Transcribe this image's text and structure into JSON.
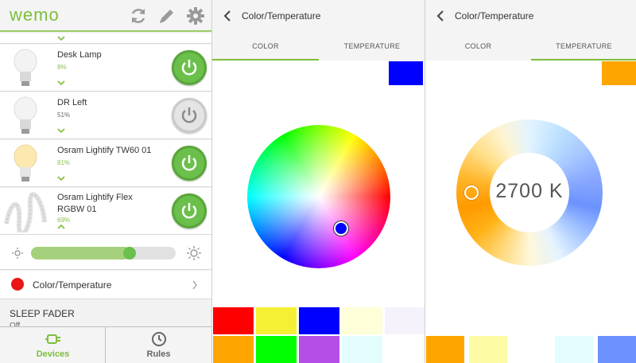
{
  "left_panel": {
    "logo": "wemo",
    "devices": [
      {
        "name": "Desk Lamp",
        "level": "8%",
        "on": true,
        "chevron": "down"
      },
      {
        "name": "DR Left",
        "level": "51%",
        "on": false,
        "chevron": "down"
      },
      {
        "name": "Osram Lightify TW60 01",
        "level": "81%",
        "on": true,
        "chevron": "down"
      },
      {
        "name": "Osram Lightify Flex",
        "name2": "RGBW 01",
        "level": "69%",
        "on": true,
        "chevron": "up"
      }
    ],
    "brightness_slider": {
      "value": 0.68
    },
    "color_row": {
      "label": "Color/Temperature",
      "color": "#e81616"
    },
    "sleep_fader": {
      "title": "SLEEP FADER",
      "value": "Off"
    },
    "nav": {
      "devices_label": "Devices",
      "rules_label": "Rules"
    },
    "colors": {
      "accent": "#7cbf3a",
      "power_on": "#6bc04b"
    }
  },
  "color_panel": {
    "title": "Color/Temperature",
    "tabs": {
      "color": "COLOR",
      "temperature": "TEMPERATURE"
    },
    "active_tab": "COLOR",
    "selected_color": "#0000ff",
    "presets": [
      "#ff0000",
      "#f5f034",
      "#0000ff",
      "#fefed8",
      "#f6f2fc",
      "#ffa500",
      "#00ff00",
      "#b44ee6",
      "#e3fdff",
      "#ffffff"
    ]
  },
  "temperature_panel": {
    "title": "Color/Temperature",
    "tabs": {
      "color": "COLOR",
      "temperature": "TEMPERATURE"
    },
    "active_tab": "TEMPERATURE",
    "temperature": "2700 K",
    "selected_color": "#ffa500",
    "presets": [
      "#ffa500",
      "#fdfba4",
      "#ffffff",
      "#e3fdff",
      "#6b92ff"
    ]
  }
}
